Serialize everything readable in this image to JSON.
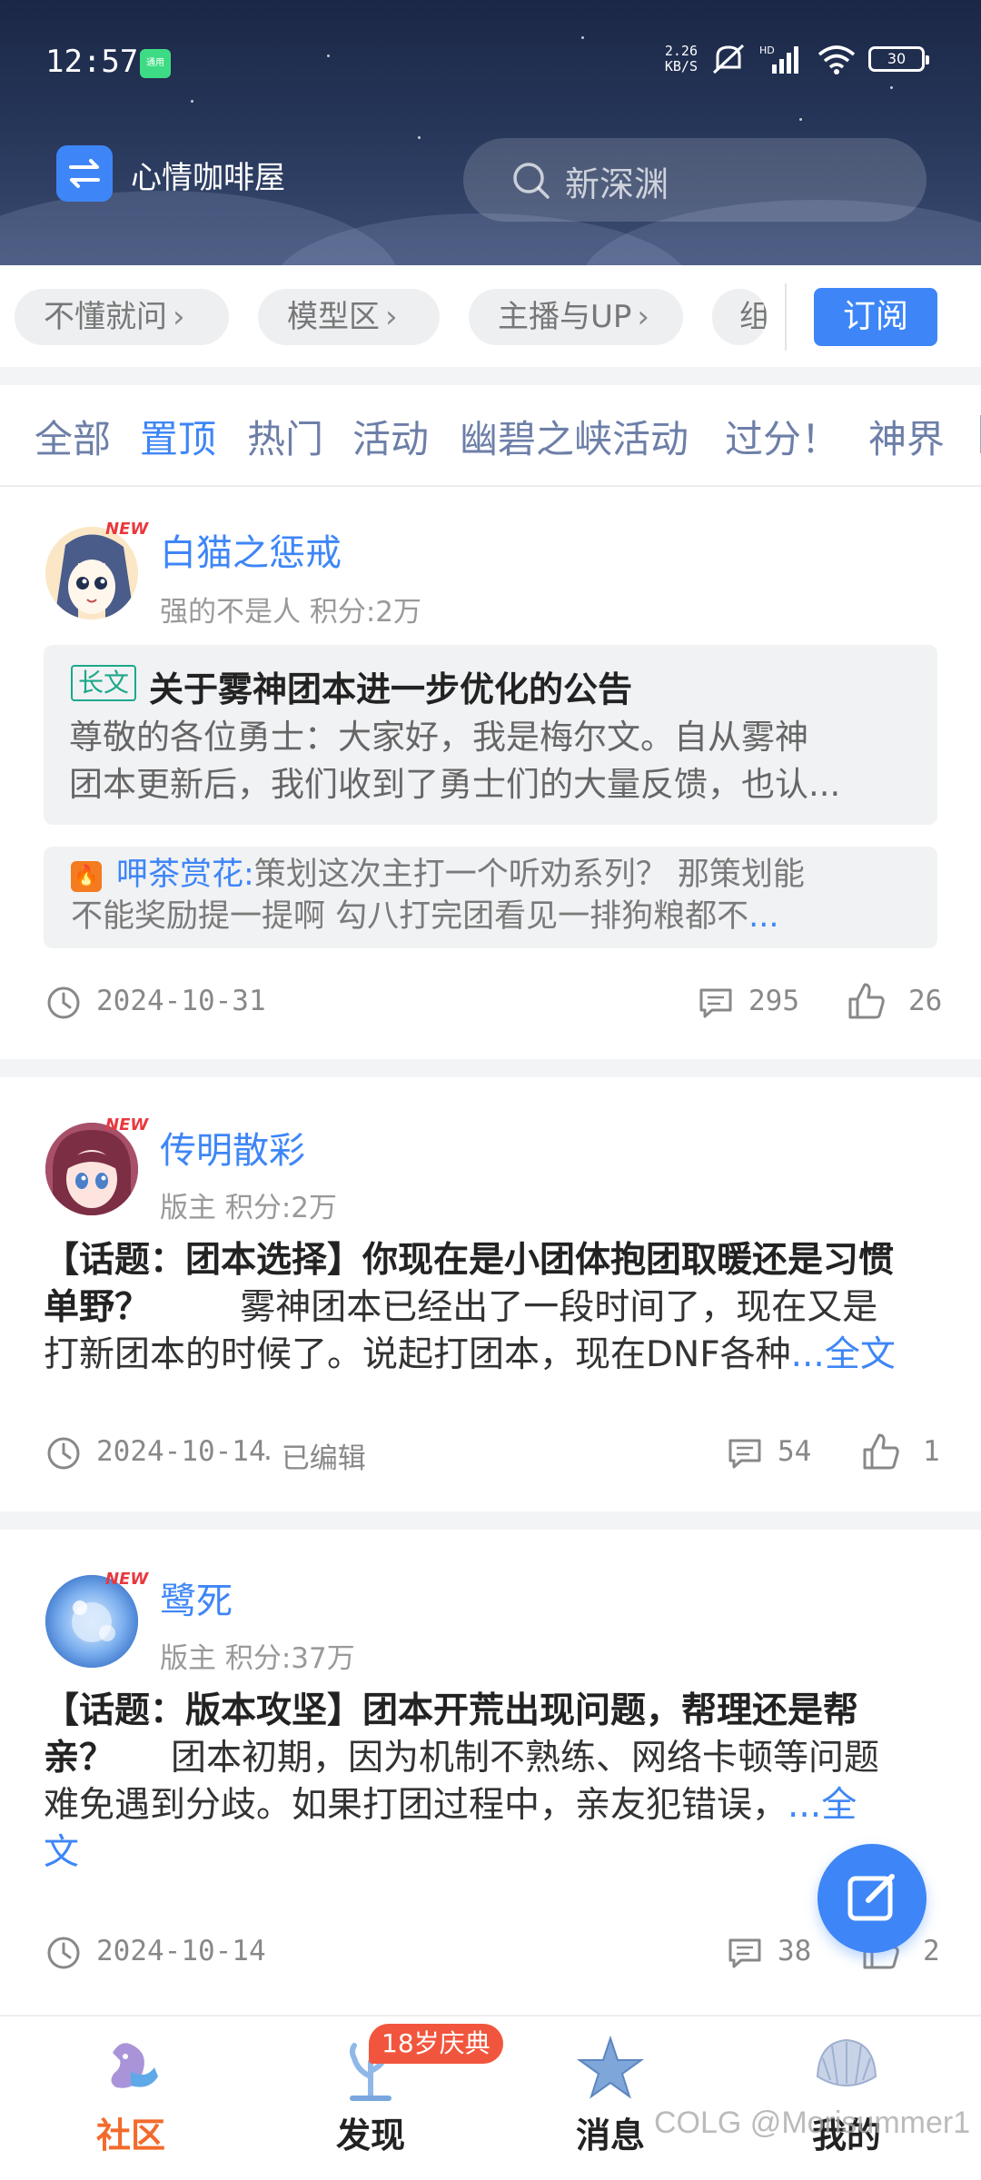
{
  "status_bar": {
    "time": "12:57",
    "notif_badge": "通用",
    "net_speed_value": "2.26",
    "net_speed_unit": "KB/S",
    "battery": "30"
  },
  "header": {
    "app_name": "心情咖啡屋",
    "search_placeholder": "新深渊"
  },
  "subforums": {
    "chips": [
      "不懂就问",
      "模型区",
      "主播与UP",
      "组"
    ],
    "subscribe_label": "订阅"
  },
  "tabs": [
    "全部",
    "置顶",
    "热门",
    "活动",
    "幽碧之峡活动",
    "过分！",
    "神界",
    "|"
  ],
  "active_tab": "置顶",
  "posts": [
    {
      "username": "白猫之惩戒",
      "new_tag": "NEW",
      "rank": "强的不是人",
      "score": "积分:2万",
      "long_tag": "长文",
      "title": "关于雾神团本进一步优化的公告",
      "excerpt_line1": "尊敬的各位勇士：大家好，我是梅尔文。自从雾神",
      "excerpt_line2": "团本更新后，我们收到了勇士们的大量反馈，也认...",
      "reply_user": "呷茶赏花:",
      "reply_line1": "策划这次主打一个听劝系列？  那策划能",
      "reply_line2": "不能奖励提一提啊  勾八打完团看见一排狗粮都不",
      "reply_more": "...",
      "date": "2024-10-31",
      "comments": "295",
      "likes": "26"
    },
    {
      "username": "传明散彩",
      "new_tag": "NEW",
      "rank": "版主",
      "score": "积分:2万",
      "topic_title": "【话题：团本选择】你现在是小团体抱团取暖还是习惯",
      "topic_line2_bold": "单野？",
      "topic_line2_rest": "        雾神团本已经出了一段时间了，现在又是",
      "topic_line3": "打新团本的时候了。说起打团本，现在DNF各种",
      "more_link": "...全文",
      "date": "2024-10-14",
      "edited": "· 已编辑",
      "comments": "54",
      "likes": "1"
    },
    {
      "username": "鹭死",
      "new_tag": "NEW",
      "rank": "版主",
      "score": "积分:37万",
      "topic_title": "【话题：版本攻坚】团本开荒出现问题，帮理还是帮",
      "topic_line2_bold": "亲？",
      "topic_line2_rest": "     团本初期，因为机制不熟练、网络卡顿等问题",
      "topic_line3": "难免遇到分歧。如果打团过程中，亲友犯错误，",
      "more_link_a": "...全",
      "more_link_b": "文",
      "date": "2024-10-14",
      "comments": "38",
      "likes": "2"
    }
  ],
  "bottom_nav": {
    "items": [
      "社区",
      "发现",
      "消息",
      "我的"
    ],
    "active": "社区",
    "event_badge": "18岁庆典"
  },
  "watermark": "COLG @Morisummer1",
  "colors": {
    "accent": "#3e86f7",
    "active_nav": "#f26b2c",
    "new_tag": "#e9383e",
    "long_tag": "#1ca88a",
    "header_bg": "#253558"
  }
}
